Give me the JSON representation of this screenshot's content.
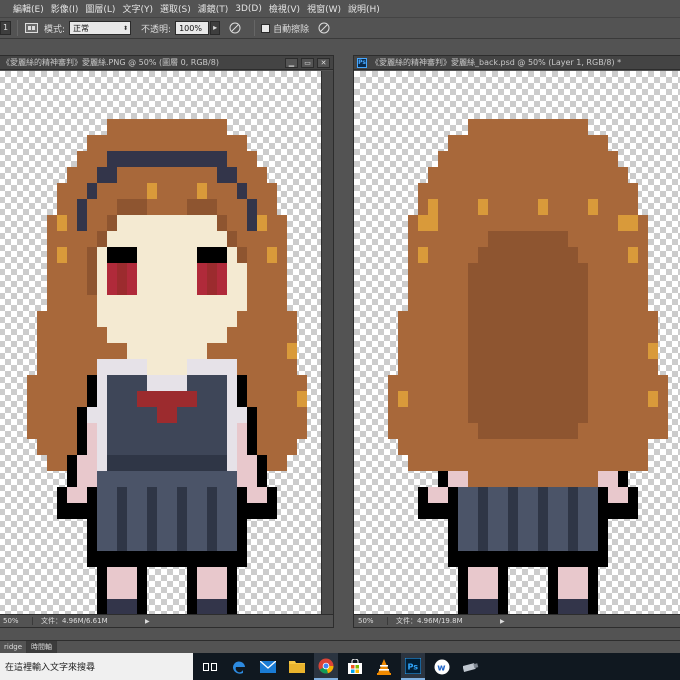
{
  "menu": {
    "items": [
      "編輯(E)",
      "影像(I)",
      "圖層(L)",
      "文字(Y)",
      "選取(S)",
      "濾鏡(T)",
      "3D(D)",
      "檢視(V)",
      "視窗(W)",
      "說明(H)"
    ]
  },
  "options": {
    "size_value": "1",
    "mode_label": "模式:",
    "mode_value": "正常",
    "opacity_label": "不透明:",
    "opacity_value": "100%",
    "auto_erase_label": "自動擦除",
    "auto_erase_checked": false
  },
  "documents": [
    {
      "title": "《愛麗絲的精神審判》愛麗絲.PNG @ 50% (圖層 0, RGB/8)",
      "zoom": "50%",
      "doc_size": "文件：4.96M/6.61M",
      "active": false
    },
    {
      "title": "《愛麗絲的精神審判》愛麗絲_back.psd @ 50% (Layer 1, RGB/8) *",
      "zoom": "50%",
      "doc_size": "文件：4.96M/19.8M",
      "active": true
    }
  ],
  "window_buttons": {
    "minimize": "▁",
    "restore": "▭",
    "close": "✕"
  },
  "panel_tabs": [
    "ridge",
    "時間軸"
  ],
  "taskbar": {
    "search_placeholder": "在這裡輸入文字來搜尋",
    "apps": [
      "task-view-icon",
      "edge-icon",
      "mail-icon",
      "file-explorer-icon",
      "chrome-icon",
      "store-icon",
      "vlc-icon",
      "photoshop-icon",
      "app-w-icon",
      "usb-drive-icon"
    ]
  },
  "colors": {
    "ui_dark": "#535353",
    "hair": "#a8683a",
    "hair_highlight": "#d99a3a",
    "skin": "#f4ead2",
    "uniform": "#3e4658",
    "bow": "#9c2b2e",
    "outline": "#000000"
  }
}
